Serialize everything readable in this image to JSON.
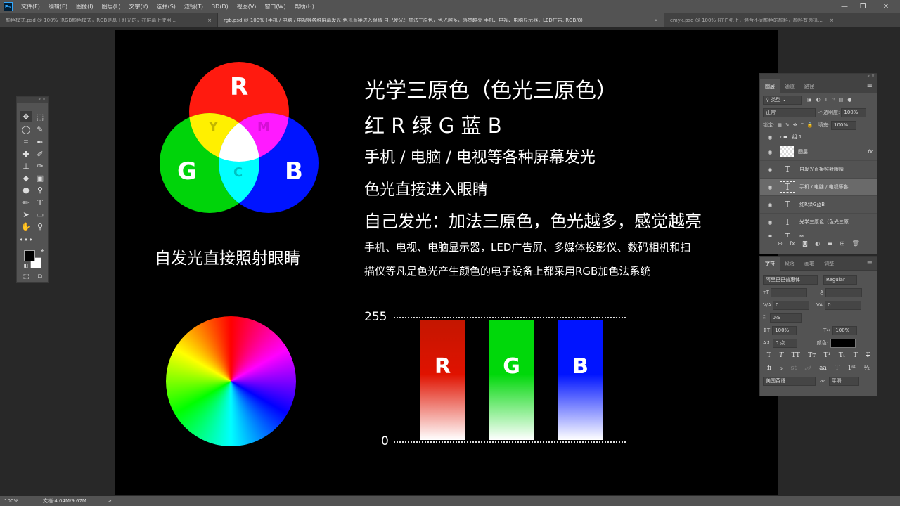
{
  "menubar": {
    "logo": "Ps",
    "items": [
      "文件(F)",
      "编辑(E)",
      "图像(I)",
      "图层(L)",
      "文字(Y)",
      "选择(S)",
      "滤镜(T)",
      "3D(D)",
      "视图(V)",
      "窗口(W)",
      "帮助(H)"
    ],
    "window_controls": {
      "minimize": "—",
      "restore": "❐",
      "close": "✕"
    }
  },
  "tabs": [
    {
      "label": "颜色模式.psd @ 100% (RGB颜色模式，RGB是基于灯光的，在屏幕上使用...",
      "active": false
    },
    {
      "label": "rgb.psd @ 100% (手机 / 电脑 / 电视等各种屏幕发光 色光直接进入眼睛 自己发光：加法三原色，色光越多，感觉越亮 手机、电视、电脑显示器，LED广告, RGB/8)",
      "active": true
    },
    {
      "label": "cmyk.psd @ 100% (在白纸上，混合不同颜色的颜料，颜料有选择的反射某...",
      "active": false
    }
  ],
  "tab_close": "×",
  "canvas": {
    "venn": {
      "r_label": "R",
      "g_label": "G",
      "b_label": "B",
      "y_label": "Y",
      "m_label": "M",
      "c_label": "C",
      "caption": "自发光直接照射眼睛",
      "colors": {
        "red": "#ff1a0f",
        "green": "#00d40a",
        "blue": "#0014ff",
        "yellow": "#fff000",
        "magenta": "#ff1aff",
        "cyan": "#00ffff",
        "white": "#ffffff"
      }
    },
    "heading1": "光学三原色（色光三原色）",
    "heading2": "红 R 绿 G 蓝 B",
    "line3": "手机 / 电脑 / 电视等各种屏幕发光",
    "line4": "色光直接进入眼睛",
    "line5": "自己发光：加法三原色，色光越多，感觉越亮",
    "para1": "手机、电视、电脑显示器，LED广告屏、多媒体投影仪、数码相机和扫",
    "para2": "描仪等凡是色光产生颜色的电子设备上都采用RGB加色法系统",
    "scale": {
      "max_label": "255",
      "min_label": "0"
    },
    "channels": [
      {
        "label": "R",
        "color": "#c41600",
        "mid": "#e01200"
      },
      {
        "label": "G",
        "color": "#00d80a",
        "mid": "#00d80a"
      },
      {
        "label": "B",
        "color": "#0014ff",
        "mid": "#0014ff"
      }
    ]
  },
  "layers_panel": {
    "tabs": [
      "图层",
      "通道",
      "路径"
    ],
    "filter": "类型",
    "blend_mode": "正常",
    "opacity_label": "不透明度:",
    "opacity": "100%",
    "lock_label": "锁定:",
    "fill_label": "填充:",
    "fill": "100%",
    "layers": [
      {
        "name": "组 1",
        "type": "group",
        "selected": false
      },
      {
        "name": "图层 1",
        "type": "image",
        "selected": false,
        "fx": "fx"
      },
      {
        "name": "自发光直接照射眼睛",
        "type": "text",
        "selected": false
      },
      {
        "name": "手机 / 电脑 / 电视等各...",
        "type": "text",
        "selected": true
      },
      {
        "name": "红R绿G蓝B",
        "type": "text",
        "selected": false
      },
      {
        "name": "光学三原色（色光三原...",
        "type": "text",
        "selected": false
      },
      {
        "name": "M",
        "type": "text",
        "selected": false
      }
    ]
  },
  "char_panel": {
    "tabs": [
      "字符",
      "段落",
      "画笔",
      "调整"
    ],
    "font_family": "阿里巴巴普惠体",
    "font_style": "Regular",
    "tracking_left": "0",
    "tracking_right": "0",
    "scale_pct": "0%",
    "vscale": "100%",
    "hscale": "100%",
    "baseline": "0 点",
    "color_label": "颜色:",
    "language": "美国英语",
    "aa_label": "aa",
    "aa_mode": "平滑"
  },
  "statusbar": {
    "zoom": "100%",
    "doc": "文档:4.04M/9.67M",
    "arrow": ">"
  }
}
